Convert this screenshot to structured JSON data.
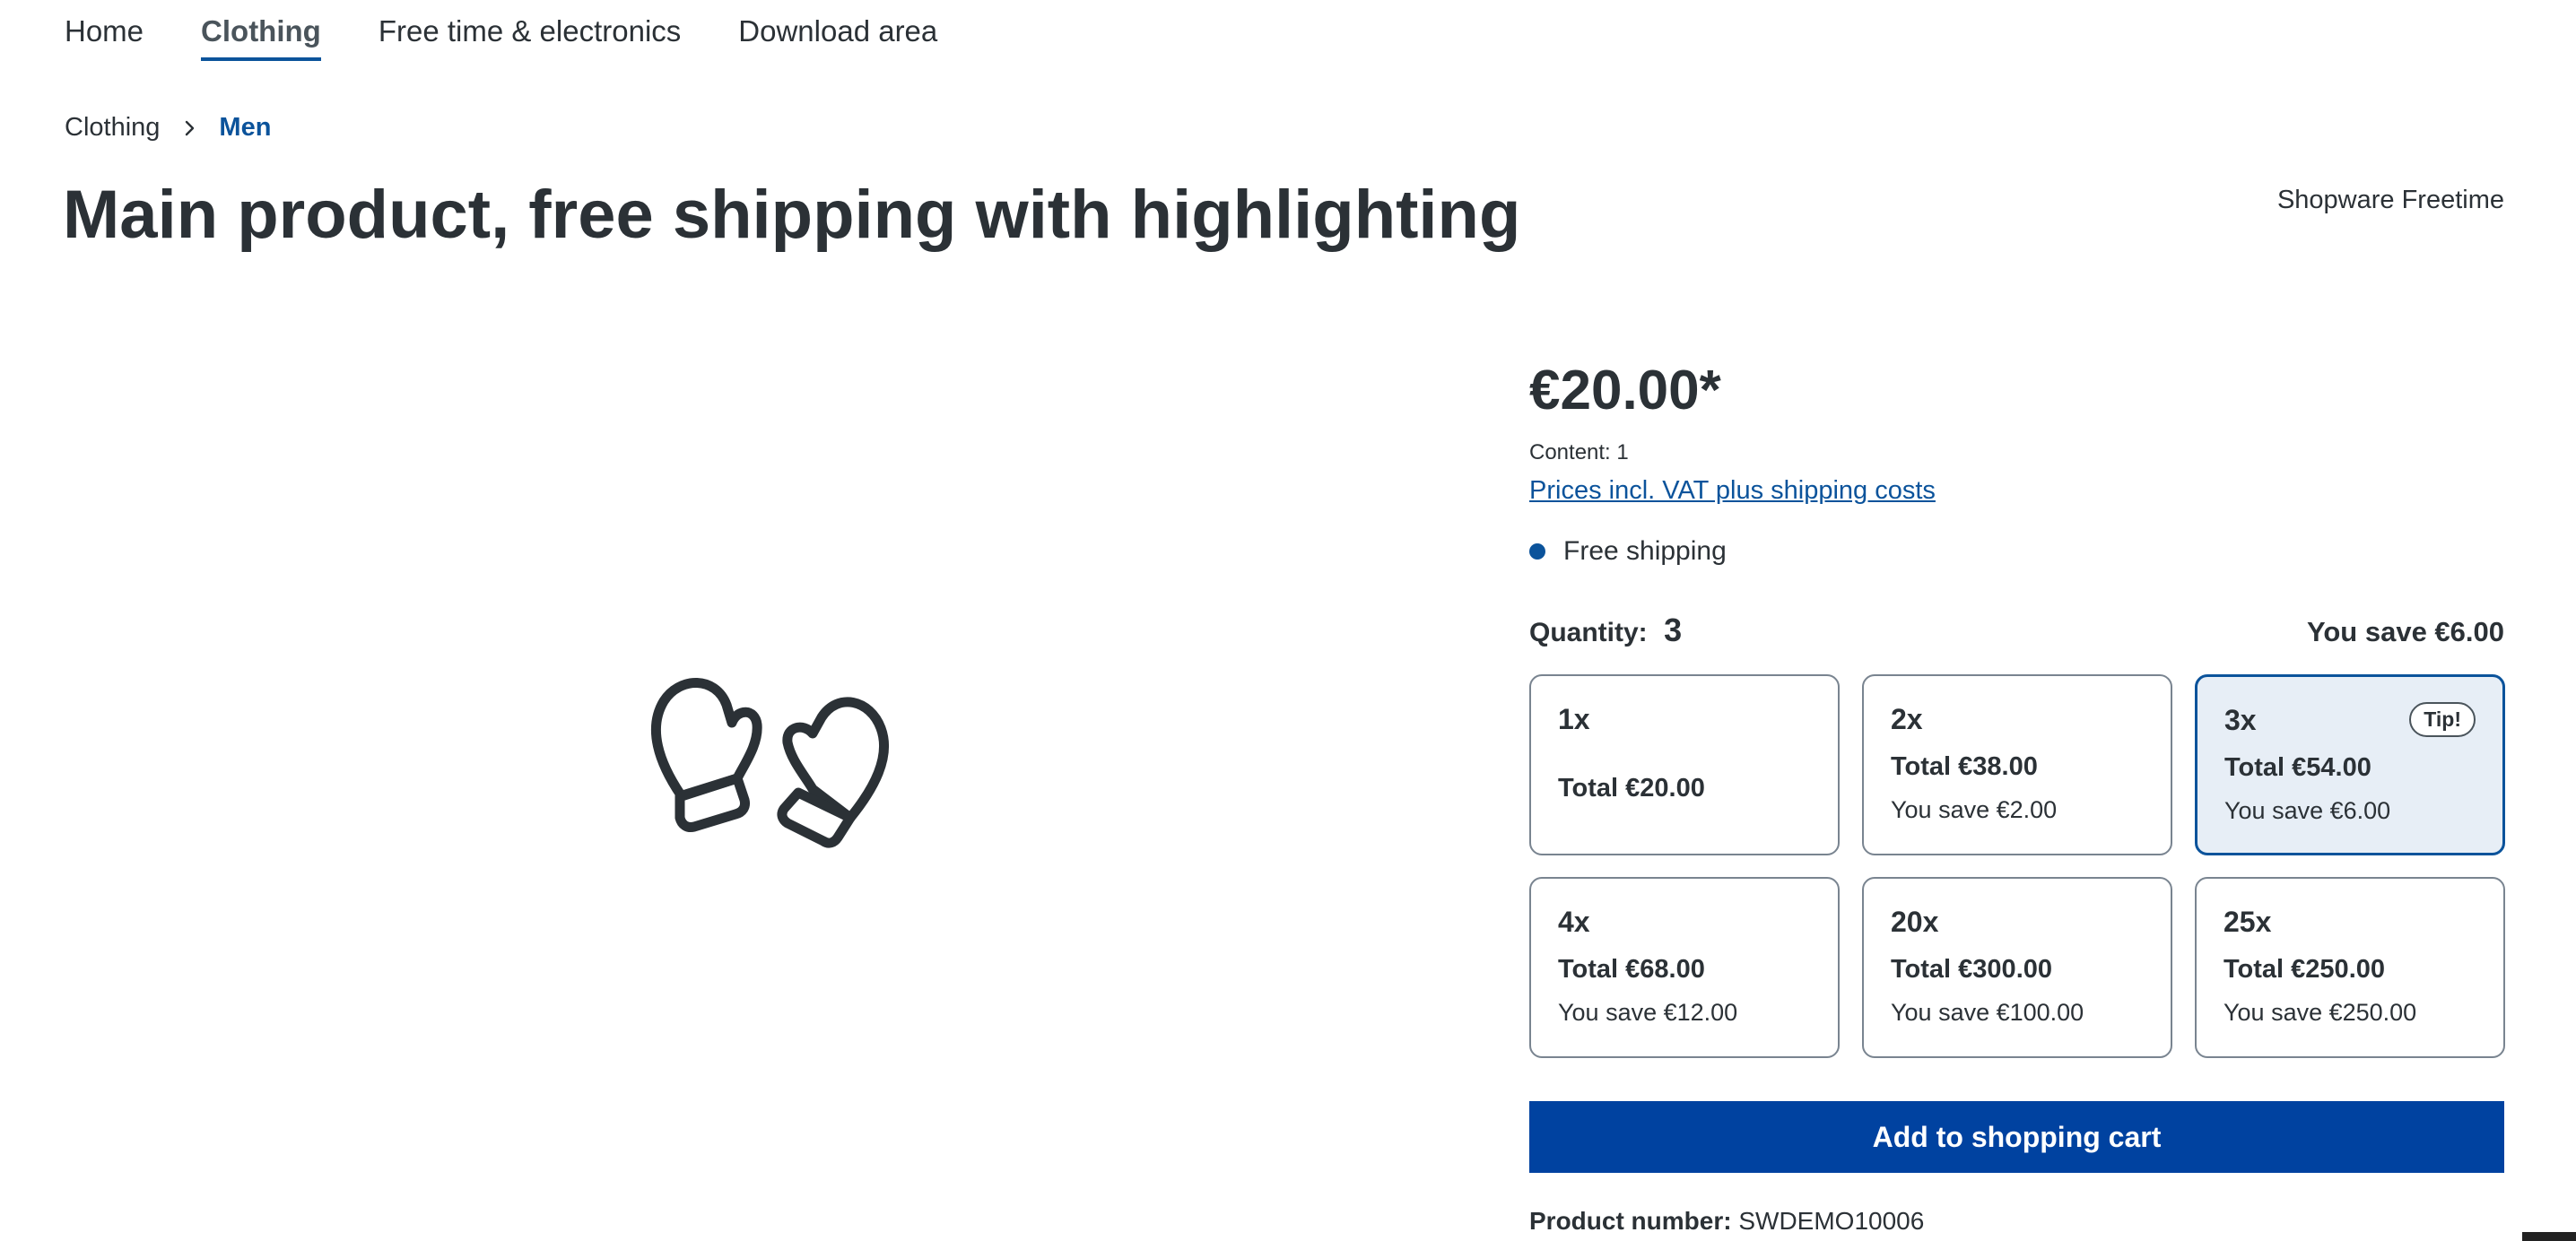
{
  "nav": {
    "items": [
      {
        "label": "Home"
      },
      {
        "label": "Clothing"
      },
      {
        "label": "Free time & electronics"
      },
      {
        "label": "Download area"
      }
    ],
    "active": "Clothing"
  },
  "breadcrumb": {
    "parent": "Clothing",
    "current": "Men"
  },
  "product": {
    "title": "Main product, free shipping with highlighting",
    "manufacturer": "Shopware Freetime",
    "image_icon": "mittens-icon",
    "price": "€20.00*",
    "content": "Content: 1",
    "tax_link": "Prices incl. VAT plus shipping costs",
    "delivery": "Free shipping",
    "quantity_label": "Quantity:",
    "quantity_value": "3",
    "quantity_savings": "You save €6.00",
    "tiers": [
      {
        "qty": "1x",
        "total": "Total €20.00",
        "save": ""
      },
      {
        "qty": "2x",
        "total": "Total €38.00",
        "save": "You save €2.00"
      },
      {
        "qty": "3x",
        "total": "Total €54.00",
        "save": "You save €6.00",
        "badge": "Tip!"
      },
      {
        "qty": "4x",
        "total": "Total €68.00",
        "save": "You save €12.00"
      },
      {
        "qty": "20x",
        "total": "Total €300.00",
        "save": "You save €100.00"
      },
      {
        "qty": "25x",
        "total": "Total €250.00",
        "save": "You save €250.00"
      }
    ],
    "selected_tier": "3x",
    "add_to_cart": "Add to shopping cart",
    "product_number_label": "Product number:",
    "product_number": "SWDEMO10006"
  },
  "colors": {
    "accent": "#0b539b",
    "button": "#0042a0",
    "selected_bg": "#e7eef6",
    "text": "#2b3136"
  }
}
